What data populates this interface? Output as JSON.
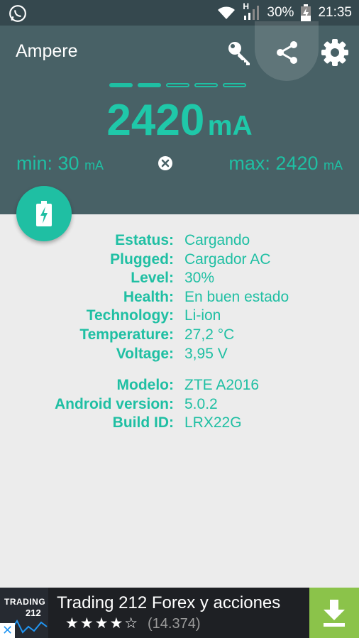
{
  "status_bar": {
    "network_type": "H",
    "battery_percent": "30%",
    "time": "21:35",
    "icons": [
      "whatsapp-icon",
      "wifi-icon",
      "signal-icon",
      "battery-charging-icon"
    ]
  },
  "toolbar": {
    "title": "Ampere",
    "actions": [
      "key-icon",
      "share-icon",
      "gear-icon"
    ]
  },
  "measurement": {
    "page_indicator": {
      "total": 5,
      "filled": 2
    },
    "current_value": "2420",
    "current_unit": "mA",
    "min_label": "min: 30",
    "min_unit": "mA",
    "max_label": "max: 2420",
    "max_unit": "mA"
  },
  "info": {
    "battery": [
      {
        "key": "Estatus:",
        "value": "Cargando"
      },
      {
        "key": "Plugged:",
        "value": "Cargador AC"
      },
      {
        "key": "Level:",
        "value": "30%"
      },
      {
        "key": "Health:",
        "value": "En buen estado"
      },
      {
        "key": "Technology:",
        "value": "Li-ion"
      },
      {
        "key": "Temperature:",
        "value": "27,2 °C"
      },
      {
        "key": "Voltage:",
        "value": "3,95 V"
      }
    ],
    "device": [
      {
        "key": "Modelo:",
        "value": "ZTE A2016"
      },
      {
        "key": "Android version:",
        "value": "5.0.2"
      },
      {
        "key": "Build ID:",
        "value": "LRX22G"
      }
    ]
  },
  "ad": {
    "logo_line1": "TRADING",
    "logo_line2": "212",
    "title": "Trading 212 Forex y acciones",
    "stars": "★★★★☆",
    "rating_value": 4,
    "rating_count": "(14.374)",
    "close_label": "✕"
  },
  "colors": {
    "accent": "#1fbfa3",
    "header_bg": "#486166",
    "status_bg": "#35484e",
    "content_bg": "#ececec",
    "ad_bg": "#1e2024",
    "ad_button": "#8bc34a"
  }
}
